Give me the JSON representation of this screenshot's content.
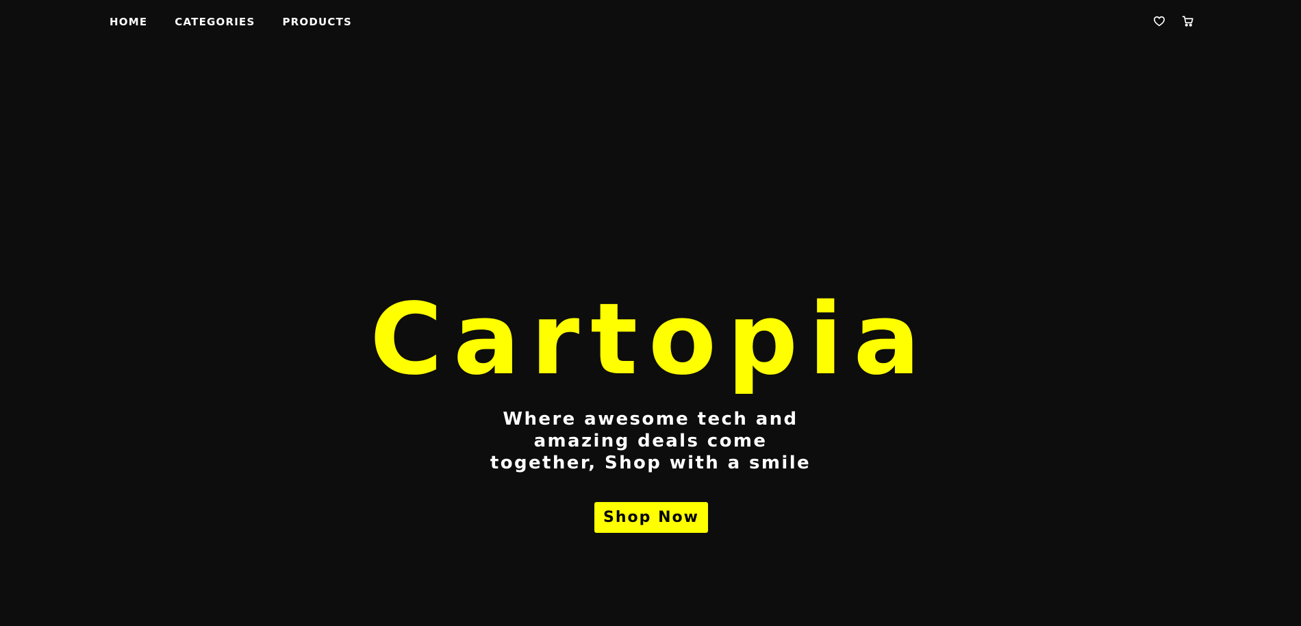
{
  "nav": {
    "links": [
      {
        "label": "HOME"
      },
      {
        "label": "CATEGORIES"
      },
      {
        "label": "PRODUCTS"
      }
    ],
    "icons": [
      {
        "name": "heart-icon"
      },
      {
        "name": "cart-icon"
      }
    ]
  },
  "hero": {
    "brand": "Cartopia",
    "tagline_lines": [
      "Where awesome tech and",
      "amazing deals come",
      "together, Shop with a smile"
    ],
    "cta_label": "Shop Now"
  },
  "colors": {
    "background": "#0d0d0d",
    "accent": "#ffff00",
    "text": "#ffffff",
    "button_text": "#000000"
  }
}
